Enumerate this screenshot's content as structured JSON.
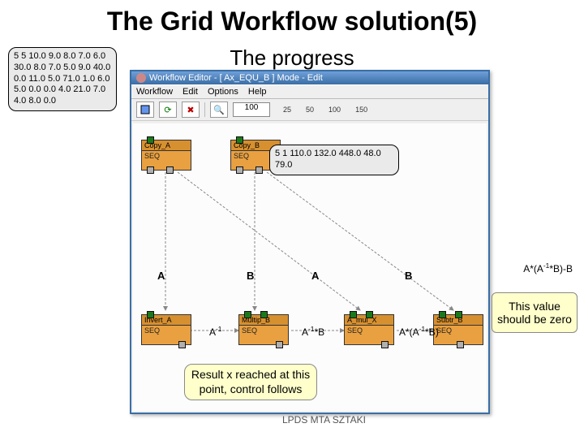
{
  "title": "The Grid Workflow solution(5)",
  "subtitle": "The progress",
  "matrix_a": "5 5 10.0 9.0 8.0 7.0 6.0 30.0 8.0 7.0 5.0 9.0 40.0 0.0 11.0 5.0 71.0 1.0 6.0 5.0 0.0 0.0 4.0 21.0 7.0 4.0 8.0 0.0",
  "matrix_b": "5 1 110.0 132.0 448.0 48.0 79.0",
  "editor": {
    "title": "Workflow Editor - [ Ax_EQU_B ] Mode - Edit",
    "menu": [
      "Workflow",
      "Edit",
      "Options",
      "Help"
    ],
    "zoom": "100",
    "ticks": [
      "25",
      "50",
      "100",
      "150"
    ]
  },
  "nodes": {
    "copy_a": {
      "name": "Copy_A",
      "sub": "SEQ"
    },
    "copy_b": {
      "name": "Copy_B",
      "sub": "SEQ"
    },
    "invert_a": {
      "name": "Invert_A",
      "sub": "SEQ"
    },
    "multip_b": {
      "name": "Multip_B",
      "sub": "SEQ"
    },
    "a_mul_x": {
      "name": "A_mul_X",
      "sub": "SEQ"
    },
    "subtr_b": {
      "name": "Subtr_B",
      "sub": "SEQ"
    }
  },
  "labels": {
    "A": "A",
    "B": "B",
    "A_inv": "A-1",
    "A_inv_B": "A-1*B",
    "A_AinvB": "A*(A-1*B)",
    "eq_right": "A*(A-1*B)-B"
  },
  "callouts": {
    "result": "Result x reached at this point, control follows",
    "zero": "This value should be zero"
  },
  "footer": "LPDS MTA SZTAKI"
}
